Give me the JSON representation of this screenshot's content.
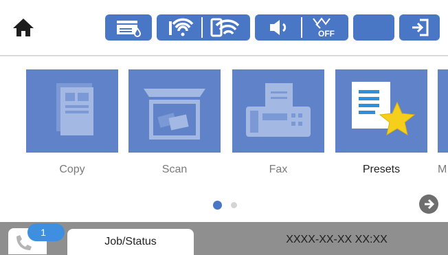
{
  "colors": {
    "status_button": "#4a76c6",
    "tile_bg": "#5f82c8",
    "bottom_bar": "#8f8f8f",
    "badge": "#3f8fe0",
    "dot_active": "#4a76c6",
    "dot_inactive": "#d4d4d4"
  },
  "topbar": {
    "home_icon": "home-icon",
    "status_icons": [
      "printer-ink-icon",
      "wifi-icon",
      "wifi-direct-icon",
      "sound-icon",
      "eco-off-icon",
      "sleep-moon-icon",
      "login-icon"
    ]
  },
  "tiles": [
    {
      "label": "Copy",
      "icon": "copy-icon"
    },
    {
      "label": "Scan",
      "icon": "scan-icon"
    },
    {
      "label": "Fax",
      "icon": "fax-icon"
    },
    {
      "label": "Presets",
      "icon": "presets-icon"
    },
    {
      "label": "M",
      "icon": "more-app-icon"
    }
  ],
  "pager": {
    "current_page": 1,
    "page_count": 2
  },
  "bottom_bar": {
    "notification_count": "1",
    "job_status_label": "Job/Status",
    "datetime": "XXXX-XX-XX XX:XX"
  }
}
